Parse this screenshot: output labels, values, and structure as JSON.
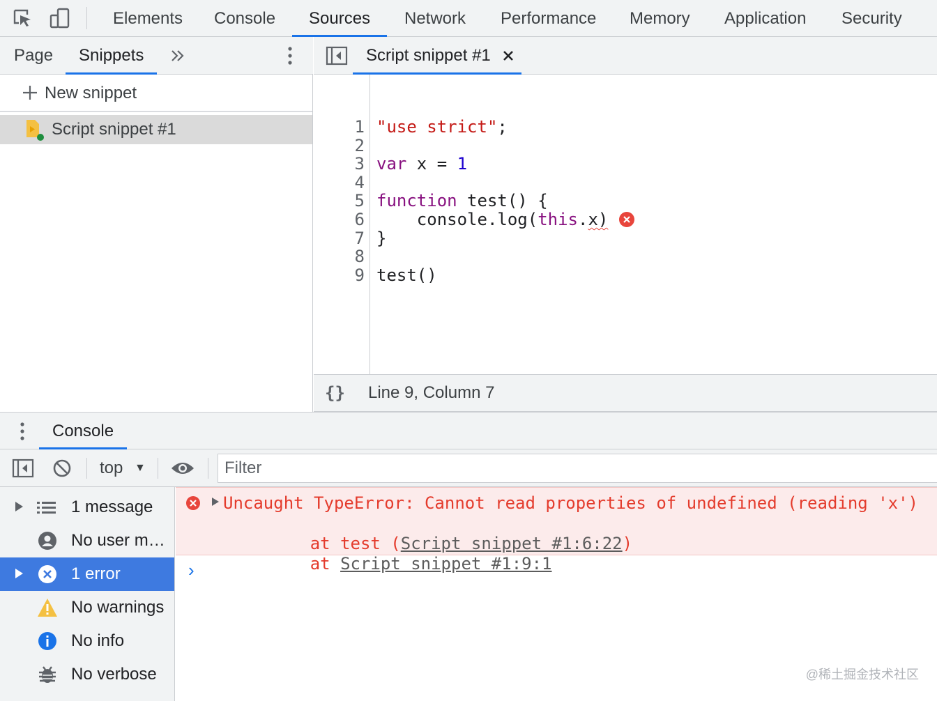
{
  "top_tabs": [
    {
      "label": "Elements"
    },
    {
      "label": "Console"
    },
    {
      "label": "Sources"
    },
    {
      "label": "Network"
    },
    {
      "label": "Performance"
    },
    {
      "label": "Memory"
    },
    {
      "label": "Application"
    },
    {
      "label": "Security"
    }
  ],
  "active_top_tab": "Sources",
  "navigator": {
    "tabs": [
      {
        "label": "Page"
      },
      {
        "label": "Snippets"
      }
    ],
    "active_tab": "Snippets",
    "new_snippet_label": "New snippet",
    "snippets": [
      {
        "label": "Script snippet #1"
      }
    ]
  },
  "editor": {
    "tab_label": "Script snippet #1",
    "line_numbers": [
      "1",
      "2",
      "3",
      "4",
      "5",
      "6",
      "7",
      "8",
      "9"
    ],
    "code": [
      "\"use strict\";",
      "",
      "var x = 1",
      "",
      "function test() {",
      "    console.log(this.x)",
      "}",
      "",
      "test()"
    ],
    "status": "Line 9, Column 7",
    "format_label": "{}"
  },
  "drawer": {
    "tab_label": "Console"
  },
  "console_toolbar": {
    "context": "top",
    "filter_placeholder": "Filter"
  },
  "console_sidebar": {
    "items": [
      {
        "label": "1 message",
        "icon": "list-icon"
      },
      {
        "label": "No user me…",
        "icon": "user-icon"
      },
      {
        "label": "1 error",
        "icon": "error-icon"
      },
      {
        "label": "No warnings",
        "icon": "warning-icon"
      },
      {
        "label": "No info",
        "icon": "info-icon"
      },
      {
        "label": "No verbose",
        "icon": "bug-icon"
      }
    ],
    "selected": "1 error"
  },
  "console_output": {
    "error_message": "Uncaught TypeError: Cannot read properties of undefined (reading 'x')",
    "stack": [
      {
        "prefix": "at test (",
        "link": "Script snippet #1:6:22",
        "suffix": ")"
      },
      {
        "prefix": "at ",
        "link": "Script snippet #1:9:1",
        "suffix": ""
      }
    ],
    "prompt": "›"
  },
  "watermark": "@稀土掘金技术社区",
  "colors": {
    "accent": "#1a73e8",
    "error_text": "#e43b2c",
    "error_bg": "#fcebeb",
    "selected_bg": "#3e7ae0",
    "keyword": "#881280",
    "string": "#c41a16",
    "number": "#1c00cf"
  }
}
